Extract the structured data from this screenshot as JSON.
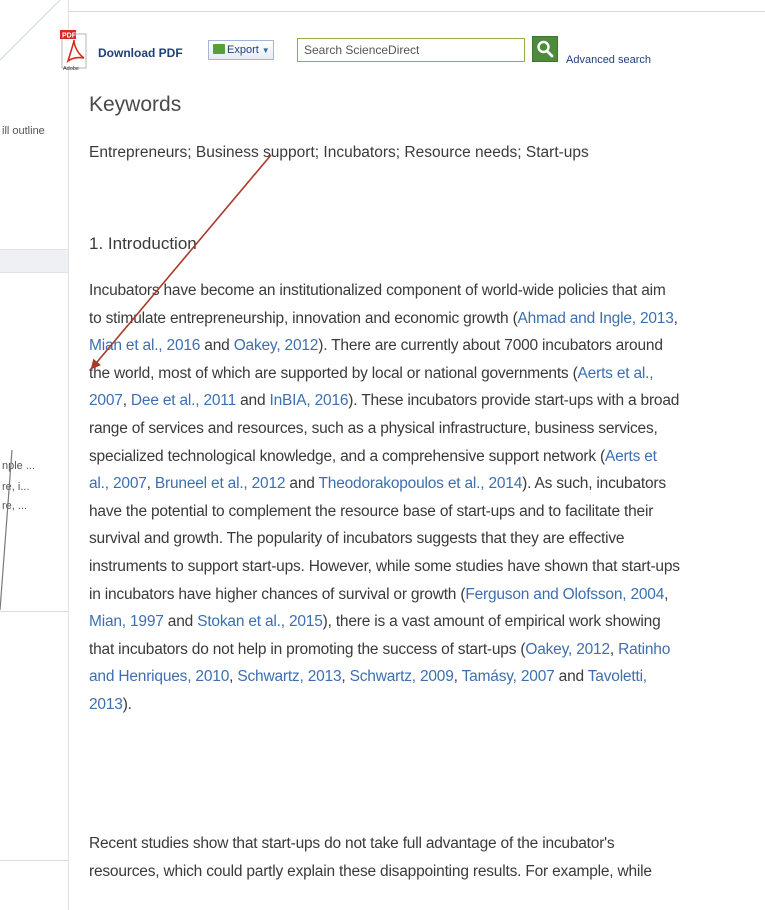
{
  "sidebar": {
    "snippet_top": "ill outline",
    "snippets": [
      "nple ...",
      "re, i...",
      "re, ..."
    ]
  },
  "toolbar": {
    "download_pdf": "Download PDF",
    "pdf_icon_label": "PDF",
    "adobe_label": "Adobe",
    "export_label": "Export",
    "search_placeholder": "Search ScienceDirect",
    "advanced_search": "Advanced search"
  },
  "article": {
    "keywords_heading": "Keywords",
    "keywords": [
      {
        "text": "Entrepreneurs",
        "sep": "; "
      },
      {
        "text": "Business support",
        "sep": "; "
      },
      {
        "text": "Incubators",
        "sep": "; "
      },
      {
        "text": "Resource needs",
        "sep": "; "
      },
      {
        "text": "Start-ups",
        "sep": ""
      }
    ],
    "section_heading": "1. Introduction",
    "paragraph1_lines": [
      [
        {
          "t": "Incubators have become an institutionalized component of world-wide policies that aim"
        }
      ],
      [
        {
          "t": "to stimulate entrepreneurship, innovation and economic growth ("
        },
        {
          "t": "Ahmad and Ingle, 2013",
          "c": true
        },
        {
          "t": ","
        }
      ],
      [
        {
          "t": "Mian et al., 2016",
          "c": true
        },
        {
          "t": " and "
        },
        {
          "t": "Oakey, 2012",
          "c": true
        },
        {
          "t": "). There are currently about 7000 incubators around"
        }
      ],
      [
        {
          "t": "the world, most of which are supported by local or national governments ("
        },
        {
          "t": "Aerts et al.,",
          "c": true
        }
      ],
      [
        {
          "t": "2007",
          "c": true
        },
        {
          "t": ", "
        },
        {
          "t": "Dee et al., 2011",
          "c": true
        },
        {
          "t": " and "
        },
        {
          "t": "InBIA, 2016",
          "c": true
        },
        {
          "t": "). These incubators provide start-ups with a broad"
        }
      ],
      [
        {
          "t": "range of services and resources, such as a physical infrastructure, business services,"
        }
      ],
      [
        {
          "t": "specialized technological knowledge, and a comprehensive support network ("
        },
        {
          "t": "Aerts et",
          "c": true
        }
      ],
      [
        {
          "t": "al., 2007",
          "c": true
        },
        {
          "t": ", "
        },
        {
          "t": "Bruneel et al., 2012",
          "c": true
        },
        {
          "t": " and "
        },
        {
          "t": "Theodorakopoulos et al., 2014",
          "c": true
        },
        {
          "t": "). As such, incubators"
        }
      ],
      [
        {
          "t": "have the potential to complement the resource base of start-ups and to facilitate their"
        }
      ],
      [
        {
          "t": "survival and growth. The popularity of incubators suggests that they are effective"
        }
      ],
      [
        {
          "t": "instruments to support start-ups. However, while some studies have shown that start-ups"
        }
      ],
      [
        {
          "t": "in incubators have higher chances of survival or growth ("
        },
        {
          "t": "Ferguson and Olofsson, 2004",
          "c": true
        },
        {
          "t": ","
        }
      ],
      [
        {
          "t": "Mian, 1997",
          "c": true
        },
        {
          "t": " and "
        },
        {
          "t": "Stokan et al., 2015",
          "c": true
        },
        {
          "t": "), there is a vast amount of empirical work showing"
        }
      ],
      [
        {
          "t": "that incubators do not help in promoting the success of start-ups ("
        },
        {
          "t": "Oakey, 2012",
          "c": true
        },
        {
          "t": ", "
        },
        {
          "t": "Ratinho",
          "c": true
        }
      ],
      [
        {
          "t": "and Henriques, 2010",
          "c": true
        },
        {
          "t": ", "
        },
        {
          "t": "Schwartz, 2013",
          "c": true
        },
        {
          "t": ", "
        },
        {
          "t": "Schwartz, 2009",
          "c": true
        },
        {
          "t": ", "
        },
        {
          "t": "Tamásy, 2007",
          "c": true
        },
        {
          "t": " and "
        },
        {
          "t": "Tavoletti,",
          "c": true
        }
      ],
      [
        {
          "t": "2013",
          "c": true
        },
        {
          "t": ")."
        }
      ]
    ],
    "paragraph2_lines": [
      [
        {
          "t": "Recent studies show that start-ups do not take full advantage of the incubator's"
        }
      ],
      [
        {
          "t": "resources, which could partly explain these disappointing results. For example, while"
        }
      ]
    ]
  },
  "colors": {
    "link": "#3d6fb0",
    "text": "#3a3a3a",
    "annotation_arrow": "#a83a2a",
    "search_button": "#4d8a3a"
  },
  "icons": [
    "pdf-icon",
    "export-icon",
    "search-icon"
  ]
}
